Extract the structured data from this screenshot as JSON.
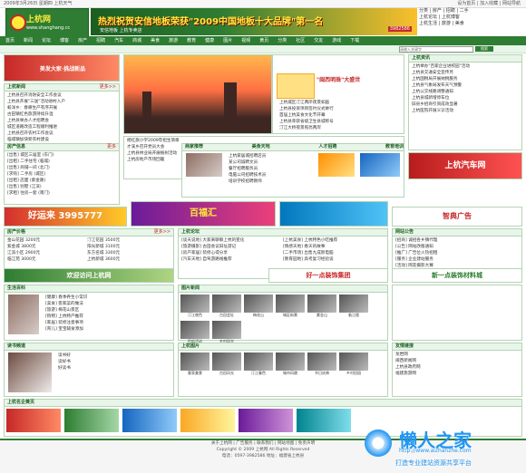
{
  "topbar": {
    "left": "2009年3月26日 星期四 上杭天气",
    "links": "设为首页 | 加入收藏 | 网站导航"
  },
  "logo": {
    "title": "上杭网",
    "sub": "www.shanghang.cc"
  },
  "banner": {
    "text": "热烈祝贺安信地板荣获\"2009中国地板十大品牌\"第一名",
    "sub": "安信地板 上杭专卖店",
    "phone": "3982586"
  },
  "navright": {
    "l1": "分类 | 房产 | 招聘 | 二手",
    "l2": "上杭论坛 | 上杭博客",
    "l3": "上杭生活 | 旅游 | 美食"
  },
  "menu": [
    "首页",
    "新闻",
    "论坛",
    "博客",
    "房产",
    "招聘",
    "汽车",
    "商城",
    "美食",
    "旅游",
    "教育",
    "健康",
    "图片",
    "视频",
    "黄页",
    "分类",
    "社区",
    "交友",
    "游戏",
    "下载"
  ],
  "search": {
    "placeholder": "请输入关键字",
    "button": "搜索"
  },
  "ad_top_left": "美发大家·挑战新品",
  "news_left": {
    "title": "上杭新闻",
    "more": "更多>>",
    "items": [
      "上杭县召开消防安全工作会议",
      "上杭县开展\"三送\"活动进村入户",
      "蛟洋乡：春耕生产有序开展",
      "古田镇红色旅游持续升温",
      "上杭县举办人才招聘会",
      "城区道路改造工程顺利推进",
      "上杭县召开农村工作会议",
      "临城镇加快新农村建设",
      "上杭一中举行春季运动会",
      "上杭县文化馆开展送戏下乡"
    ]
  },
  "center_caption": "\"闽西明珠\"大盛世",
  "center_news": [
    "上杭城区汀江两岸夜景如画",
    "上杭县投资项目签约仪式举行",
    "首届上杭美食文化节开幕",
    "上杭县荣获省级卫生县城称号",
    "汀江大桥夜景照亮两岸"
  ],
  "center_list": [
    "杨红旗小学2009年招生简章",
    "才溪乡召开党员大会",
    "上杭县林业局开展植树活动",
    "上杭房地产市场回暖"
  ],
  "right_box": {
    "title": "上杭资讯",
    "items": [
      "上杭举办\"百家企业进校园\"活动",
      "上杭县交通安全宣传月",
      "上杭国税局开展纳税服务",
      "上杭县气象局发布天气预警",
      "上杭公交线路调整通知",
      "上杭县城新增停车位",
      "旧县乡招商引资成效显著",
      "上杭医院开展义诊活动"
    ]
  },
  "ad_right": "上杭汽车网",
  "house": {
    "title": "房产信息",
    "more": "更多",
    "items": [
      "[出售] 城区三居室 (东门)",
      "[出租] 二手住宅 (临城)",
      "[出售] 商铺一间 (北门)",
      "[求购] 二手房 (城区)",
      "[出租] 店面 (紫金路)",
      "[出售] 别墅 (江滨)",
      "[求租] 住房一套 (南门)"
    ]
  },
  "job": {
    "title": "招聘信息",
    "items": [
      "上杭家居城招聘店员",
      "某公司诚聘文员",
      "餐厅招聘服务员",
      "电脑公司招聘技术员",
      "培训学校招聘教师"
    ]
  },
  "mid_tabs": [
    "商家推荐",
    "美食天地",
    "人才招聘",
    "教育培训"
  ],
  "ad_strip1": "好运来 3995777",
  "ad_strip2": "百福汇",
  "ad_strip3": "智典广告",
  "price": {
    "title": "房产价格",
    "more": "更多>>",
    "rows": [
      [
        "金山花园",
        "3200元"
      ],
      [
        "汀江花园",
        "3500元"
      ],
      [
        "紫金城",
        "3800元"
      ],
      [
        "阳光新城",
        "3100元"
      ],
      [
        "江滨小区",
        "2900元"
      ],
      [
        "东方名城",
        "3300元"
      ],
      [
        "临江苑",
        "3000元"
      ],
      [
        "上杭新城",
        "3600元"
      ]
    ]
  },
  "forum": {
    "title": "上杭论坛",
    "items": [
      "[谈天说地] 大家来聊聊上杭的变化",
      "[上杭美食] 上杭特色小吃推荐",
      "[旅游摄影] 古田会议旧址游记",
      "[情感天地] 春天的故事",
      "[房产家居] 装修心得分享",
      "[二手市场] 出售九成新电脑",
      "[汽车天地] 自驾游路线推荐",
      "[教育园地] 高考复习经验谈"
    ]
  },
  "ad_mid_right1": "好一点装饰集团",
  "ad_mid_right2": "新一点装饰材料城",
  "ad_left_small": "欢迎访问上杭网",
  "life": {
    "title": "生活百科",
    "items": [
      "[健康] 春季养生小常识",
      "[美食] 客家菜的做法",
      "[旅游] 梅花山景区",
      "[购物] 上杭特产推荐",
      "[家居] 装修注意事项",
      "[育儿] 宝宝辅食添加"
    ]
  },
  "photo": {
    "title": "图片新闻",
    "caps": [
      "汀江夜色",
      "古田会址",
      "梅花山",
      "城区街景",
      "紫金山",
      "临江楼",
      "民俗活动",
      "乡村风光"
    ]
  },
  "right_mid": {
    "title": "网站公告",
    "items": [
      "[招商] 诚招各乡镇代理",
      "[公告] 网站改版通知",
      "[推广] 广告位火热招租",
      "[服务] 企业建站服务",
      "[活动] 网友摄影大赛"
    ]
  },
  "read": {
    "title": "读书频道",
    "items": [
      "读书好",
      "读好书",
      "好读书"
    ]
  },
  "bottom_left": "上杭名企黄页",
  "bottom_photos": {
    "title": "上杭图片",
    "caps": [
      "客家美食",
      "古田风光",
      "汀江春色",
      "城市风貌",
      "节日庆典",
      "乡村田园"
    ]
  },
  "bottom_right": {
    "title": "友情链接",
    "items": [
      "龙岩网",
      "闽西新闻网",
      "上杭县政府网",
      "福建旅游网"
    ]
  },
  "footer": {
    "l1": "关于上杭网 | 广告服务 | 联系我们 | 网站地图 | 免责声明",
    "l2": "Copyright © 2009 上杭网 All Rights Reserved",
    "l3": "电话：0597-3982586 地址：福建省上杭县"
  },
  "watermark": {
    "brand": "懒人之家",
    "url": "http://www.aizhanzhe.com",
    "slogan": "打造专业建站资源共享平台"
  }
}
